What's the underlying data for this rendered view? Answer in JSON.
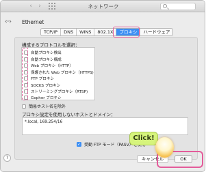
{
  "window": {
    "title": "ネットワーク",
    "nav_back": "‹",
    "nav_forward": "›"
  },
  "connection": {
    "back_icon": "‹··›",
    "name": "Ethernet"
  },
  "tabs": [
    {
      "label": "TCP/IP",
      "active": false
    },
    {
      "label": "DNS",
      "active": false
    },
    {
      "label": "WINS",
      "active": false
    },
    {
      "label": "802.1X",
      "active": false
    },
    {
      "label": "プロキシ",
      "active": true
    },
    {
      "label": "ハードウェア",
      "active": false
    }
  ],
  "protocols": {
    "label": "構成するプロトコルを選択：",
    "items": [
      {
        "label": "自動プロキシ検出",
        "checked": false
      },
      {
        "label": "自動プロキシ構成",
        "checked": false
      },
      {
        "label": "Web プロキシ（HTTP）",
        "checked": false
      },
      {
        "label": "保護された Web プロキシ（HTTPS)",
        "checked": false
      },
      {
        "label": "FTP プロキシ",
        "checked": false
      },
      {
        "label": "SOCKS プロキシ",
        "checked": false
      },
      {
        "label": "ストリーミングプロキシ（RTSP)",
        "checked": false
      },
      {
        "label": "Gopher プロキシ",
        "checked": false
      }
    ]
  },
  "simple_hostnames": {
    "label": "簡易ホスト名を除外",
    "checked": false
  },
  "bypass": {
    "label": "プロキシ設定を使用しないホストとドメイン：",
    "value": "*.local, 169.254/16"
  },
  "pasv": {
    "label": "受動 FTP モード（PASV）を使用",
    "checked": true
  },
  "buttons": {
    "help": "?",
    "cancel": "キャンセル",
    "ok": "OK"
  },
  "overlay": {
    "click_label": "Click!"
  },
  "colors": {
    "accent": "#3d8ff4",
    "highlight": "#e35c9a",
    "bubble": "#d6f47c"
  }
}
